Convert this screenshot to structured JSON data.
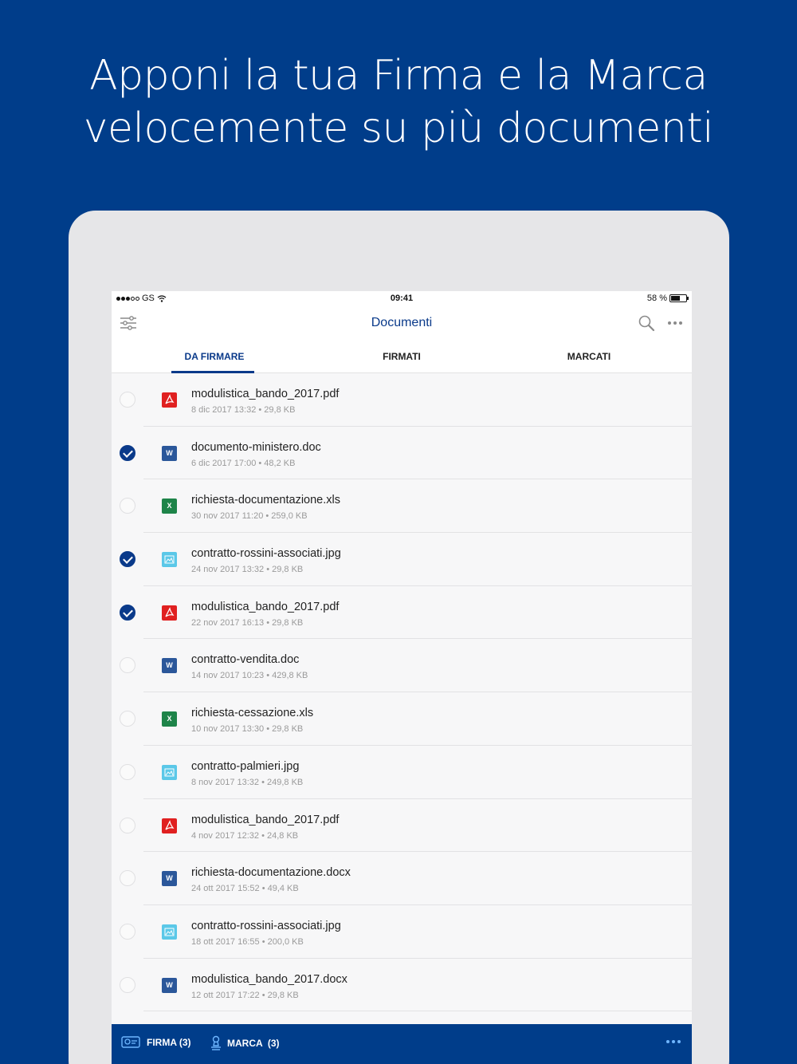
{
  "headline": {
    "line1": "Apponi la tua Firma e la Marca",
    "line2": "velocemente su più documenti"
  },
  "statusbar": {
    "carrier": "GS",
    "time": "09:41",
    "battery": "58 %"
  },
  "navbar": {
    "title": "Documenti"
  },
  "tabs": [
    {
      "label": "DA FIRMARE",
      "active": true
    },
    {
      "label": "FIRMATI",
      "active": false
    },
    {
      "label": "MARCATI",
      "active": false
    }
  ],
  "documents": [
    {
      "name": "modulistica_bando_2017.pdf",
      "meta": "8 dic 2017 13:32 • 29,8 KB",
      "type": "pdf",
      "icon_label": "",
      "selected": false
    },
    {
      "name": "documento-ministero.doc",
      "meta": "6 dic 2017 17:00 • 48,2 KB",
      "type": "word",
      "icon_label": "W",
      "selected": true
    },
    {
      "name": "richiesta-documentazione.xls",
      "meta": "30 nov 2017 11:20 • 259,0 KB",
      "type": "excel",
      "icon_label": "X",
      "selected": false
    },
    {
      "name": "contratto-rossini-associati.jpg",
      "meta": "24 nov 2017 13:32 • 29,8 KB",
      "type": "image",
      "icon_label": "",
      "selected": true
    },
    {
      "name": "modulistica_bando_2017.pdf",
      "meta": "22 nov 2017 16:13 • 29,8 KB",
      "type": "pdf",
      "icon_label": "",
      "selected": true
    },
    {
      "name": "contratto-vendita.doc",
      "meta": "14 nov 2017 10:23 • 429,8 KB",
      "type": "word",
      "icon_label": "W",
      "selected": false
    },
    {
      "name": "richiesta-cessazione.xls",
      "meta": "10 nov 2017 13:30 • 29,8 KB",
      "type": "excel",
      "icon_label": "X",
      "selected": false
    },
    {
      "name": "contratto-palmieri.jpg",
      "meta": "8 nov 2017 13:32 • 249,8 KB",
      "type": "image",
      "icon_label": "",
      "selected": false
    },
    {
      "name": "modulistica_bando_2017.pdf",
      "meta": "4 nov 2017 12:32 • 24,8 KB",
      "type": "pdf",
      "icon_label": "",
      "selected": false
    },
    {
      "name": "richiesta-documentazione.docx",
      "meta": "24 ott 2017 15:52 • 49,4 KB",
      "type": "word",
      "icon_label": "W",
      "selected": false
    },
    {
      "name": "contratto-rossini-associati.jpg",
      "meta": "18 ott 2017 16:55 • 200,0 KB",
      "type": "image",
      "icon_label": "",
      "selected": false
    },
    {
      "name": "modulistica_bando_2017.docx",
      "meta": "12 ott 2017 17:22 • 29,8 KB",
      "type": "word",
      "icon_label": "W",
      "selected": false
    }
  ],
  "bottombar": {
    "firma_label": "FIRMA (3)",
    "marca_label": "MARCA  (3)"
  },
  "colors": {
    "brand": "#003d8a",
    "accent": "#0a3a8a",
    "pdf": "#e02020",
    "word": "#2b579a",
    "excel": "#1e8449",
    "image": "#5bc8e8"
  },
  "icons": {
    "filter": "sliders-icon",
    "search": "search-icon",
    "more": "ellipsis-icon",
    "firma": "signature-card-icon",
    "marca": "stamp-icon"
  }
}
